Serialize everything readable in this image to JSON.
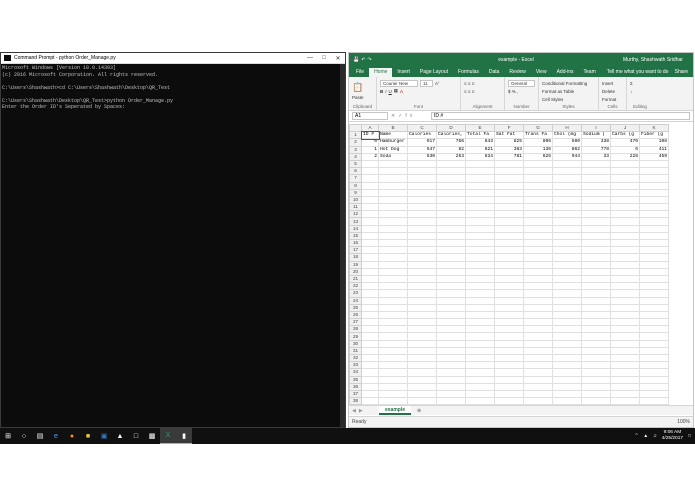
{
  "cmd": {
    "title": "Command Prompt - python  Order_Manage.py",
    "lines": [
      "Microsoft Windows [Version 10.0.14393]",
      "(c) 2016 Microsoft Corporation. All rights reserved.",
      "",
      "C:\\Users\\Shashwath>cd C:\\Users\\Shashwath\\Desktop\\QR_Test",
      "",
      "C:\\Users\\Shashwath\\Desktop\\QR_Test>python Order_Manage.py",
      "Enter the Order ID's Seperated by Spaces:"
    ]
  },
  "excel": {
    "title": "example - Excel",
    "user": "Murthy, Shashwath Sridhar",
    "tabs": [
      "File",
      "Home",
      "Insert",
      "Page Layout",
      "Formulas",
      "Data",
      "Review",
      "View",
      "Add-ins",
      "Team"
    ],
    "tell_me": "Tell me what you want to do",
    "share": "Share",
    "ribbon": {
      "paste": "Paste",
      "clipboard": "Clipboard",
      "font_name": "Courier New",
      "font_size": "11",
      "font": "Font",
      "alignment": "Alignment",
      "number_format": "General",
      "number": "Number",
      "conditional": "Conditional Formatting",
      "format_table": "Format as Table",
      "cell_styles": "Cell Styles",
      "styles": "Styles",
      "insert": "Insert",
      "delete": "Delete",
      "format": "Format",
      "cells": "Cells",
      "editing": "Editing"
    },
    "name_box": "A1",
    "formula": "ID #",
    "columns": [
      "A",
      "B",
      "C",
      "D",
      "E",
      "F",
      "G",
      "H",
      "I",
      "J",
      "K"
    ],
    "rows": [
      [
        "ID #",
        "Name",
        "Calories",
        "Calories,",
        "Total Fa",
        "Sat Fat",
        "Trans Fa",
        "Chol (mg",
        "Sodium (",
        "Carbs (g",
        "Fiber (g"
      ],
      [
        "0",
        "Hamburger",
        "917",
        "766",
        "643",
        "825",
        "806",
        "580",
        "338",
        "470",
        "108"
      ],
      [
        "1",
        "Hot Dog",
        "547",
        "82",
        "621",
        "383",
        "136",
        "862",
        "778",
        "6",
        "411"
      ],
      [
        "2",
        "Soda",
        "530",
        "253",
        "634",
        "781",
        "625",
        "944",
        "33",
        "228",
        "459"
      ]
    ],
    "row_count": 38,
    "sheet_tab": "example",
    "status": "Ready",
    "zoom": "100%"
  },
  "taskbar": {
    "time": "9:06 AM",
    "date": "4/25/2017"
  }
}
